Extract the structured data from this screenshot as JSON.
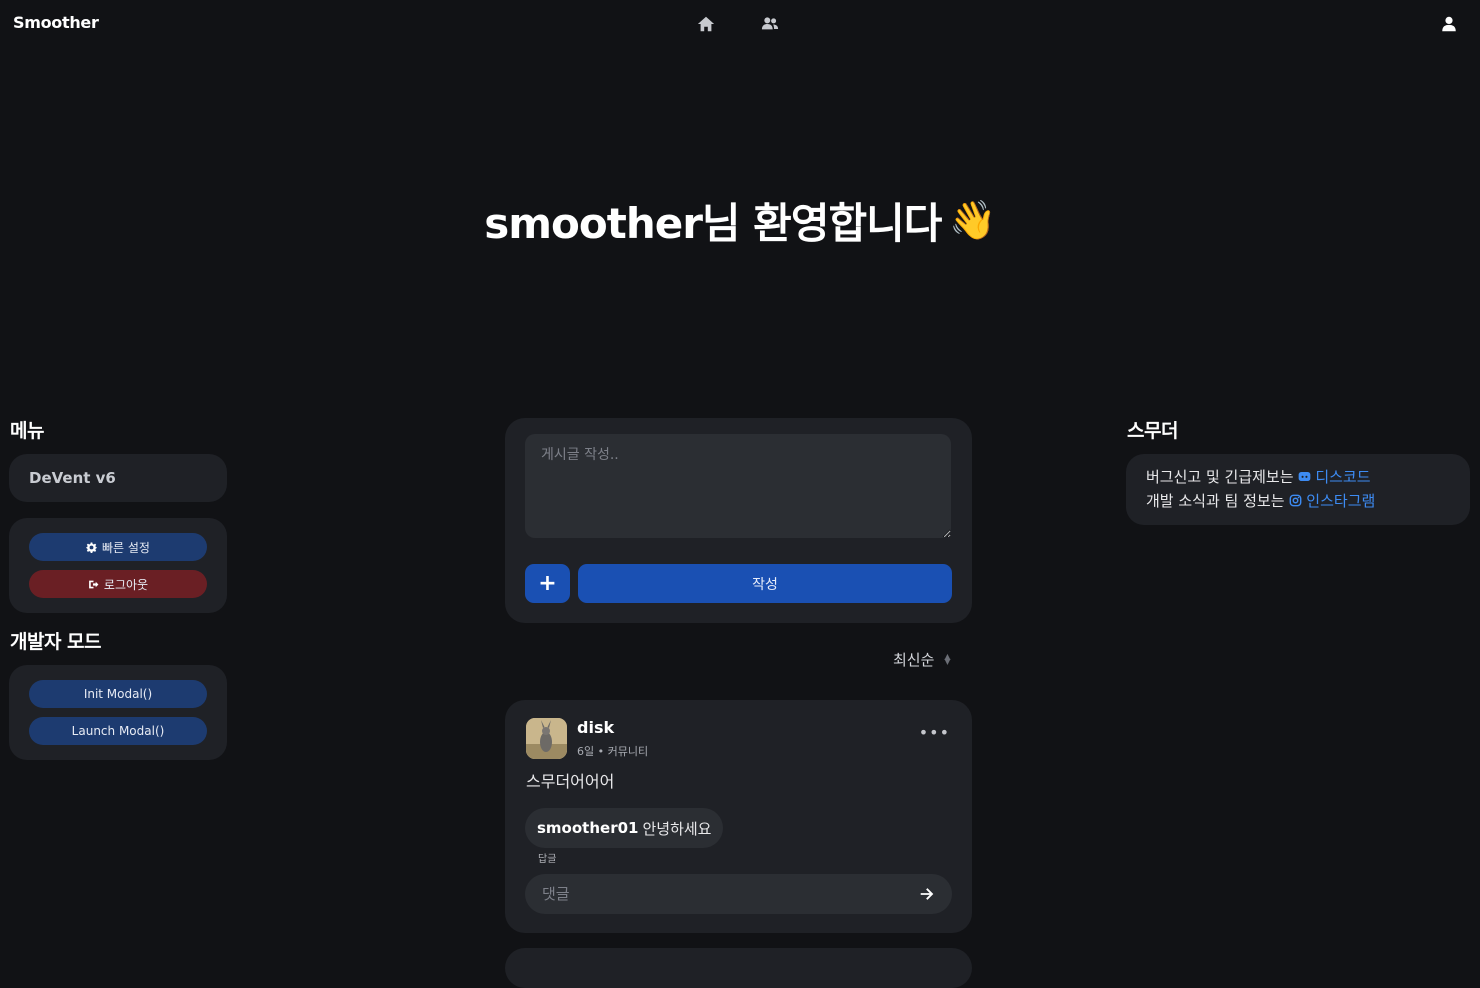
{
  "app": {
    "brand": "Smoother"
  },
  "nav": {
    "icons": [
      "home-icon",
      "users-icon",
      "user-icon"
    ]
  },
  "hero": {
    "title": "smoother님 환영합니다",
    "emoji": "👋"
  },
  "left": {
    "menu_heading": "메뉴",
    "version_label": "DeVent v6",
    "quick_settings": "빠른 설정",
    "logout": "로그아웃",
    "dev_heading": "개발자 모드",
    "init_modal": "Init Modal()",
    "launch_modal": "Launch Modal()"
  },
  "right": {
    "heading": "스무더",
    "line1_text": "버그신고 및 긴급제보는",
    "line1_link": "디스코드",
    "line2_text": "개발 소식과 팀 정보는",
    "line2_link": "인스타그램"
  },
  "composer": {
    "placeholder": "게시글 작성..",
    "plus_label": "+",
    "submit_label": "작성"
  },
  "sort": {
    "label": "최신순"
  },
  "post": {
    "author": "disk",
    "meta": "6일 • 커뮤니티",
    "body": "스무더어어어",
    "comment_user": "smoother01",
    "comment_text": "안녕하세요",
    "reply_label": "답글",
    "comment_placeholder": "댓글"
  },
  "colors": {
    "background": "#111215",
    "card": "#1f2126",
    "accent_blue": "#1a50b3",
    "danger": "#6a1f24",
    "link": "#3d8bf2"
  }
}
